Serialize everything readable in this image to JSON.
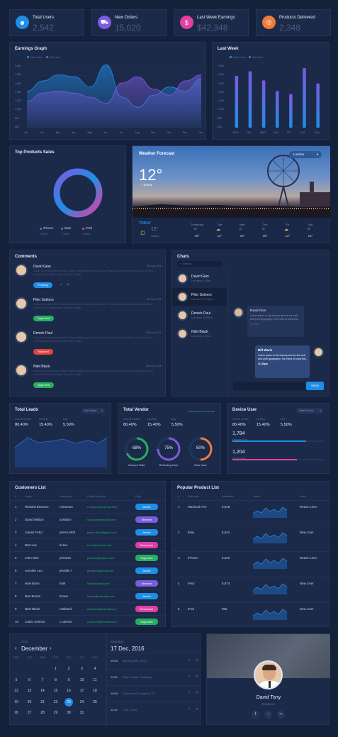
{
  "colors": {
    "bg": "#15203a",
    "card": "#1c2a4a",
    "blue": "#1f8ee6",
    "purple": "#7b5be0",
    "pink": "#e23fa2",
    "orange": "#f07b3a",
    "green": "#27ae60",
    "red": "#e0443c"
  },
  "stats": [
    {
      "label": "Total Users",
      "value": "2,542",
      "icon": "users-icon",
      "color": "#1f8ee6"
    },
    {
      "label": "New Orders",
      "value": "15,020",
      "icon": "cart-icon",
      "color": "#7b5be0"
    },
    {
      "label": "Last Week Earnings",
      "value": "$42,348",
      "icon": "dollar-icon",
      "color": "#e23fa2"
    },
    {
      "label": "Products Delivered",
      "value": "2,348",
      "icon": "delivery-icon",
      "color": "#f07b3a"
    }
  ],
  "earnings": {
    "title": "Earnings Graph",
    "legend": [
      "New User",
      "Old User"
    ],
    "chart_data": {
      "type": "area",
      "x": [
        "Jan",
        "Feb",
        "Mar",
        "Apr",
        "May",
        "Jun",
        "Jul",
        "Aug",
        "Sep",
        "Oct",
        "Nov",
        "Dec"
      ],
      "series": [
        {
          "name": "New User",
          "values": [
            1400,
            1650,
            1800,
            1750,
            1500,
            2050,
            1250,
            1000,
            1300,
            1500,
            1400,
            1700
          ]
        },
        {
          "name": "Old User",
          "values": [
            1150,
            1350,
            1400,
            1350,
            1250,
            1100,
            1600,
            1750,
            1450,
            1300,
            1650,
            1800
          ]
        }
      ],
      "ylim": [
        500,
        2000
      ],
      "yticks": [
        "2,000",
        "1,800",
        "1,600",
        "1,400",
        "1,200",
        "1,000",
        "800",
        "600"
      ]
    }
  },
  "lastweek": {
    "title": "Last Week",
    "legend": [
      "New User",
      "Old User"
    ],
    "chart_data": {
      "type": "bar",
      "categories": [
        "MON",
        "TUE",
        "WED",
        "THU",
        "FRI",
        "SAT",
        "SUN"
      ],
      "values": [
        1700,
        1850,
        1550,
        1200,
        1100,
        1950,
        1450
      ],
      "ylim": [
        0,
        2000
      ],
      "yticks": [
        "2,000",
        "1,800",
        "1,600",
        "1,400",
        "1,200",
        "1,000",
        "800",
        "600"
      ]
    }
  },
  "topproducts": {
    "title": "Top Products Sales",
    "chart_data": {
      "type": "pie",
      "series": [
        {
          "name": "iPhone",
          "value": "4,530"
        },
        {
          "name": "iMac",
          "value": "7,030"
        },
        {
          "name": "iPad",
          "value": "5,644"
        }
      ]
    }
  },
  "weather": {
    "title": "Weather Forecast",
    "city": "London",
    "temp": "12°",
    "cond": "Sunny",
    "today": "TODAY",
    "today_temp": "12°",
    "today_cond": "Sunny",
    "days": [
      {
        "d": "Tomorrow",
        "t": "18°"
      },
      {
        "d": "Tue",
        "t": "12°"
      },
      {
        "d": "Wed",
        "t": "18°"
      },
      {
        "d": "Thu",
        "t": "18°"
      },
      {
        "d": "Fri",
        "t": "12°"
      },
      {
        "d": "Sat",
        "t": "12°"
      }
    ]
  },
  "comments": {
    "title": "Comments",
    "items": [
      {
        "name": "David Gian",
        "date": "9th Aug 2016",
        "text": "Donec ac condimentum massa. Etiam pellentesque pretium lacus. Phasellus ultricies dictum suscipit. Aenean commodo dui pellentesque molestie feugiat.",
        "status": "Pending",
        "color": "#1f8ee6"
      },
      {
        "name": "Piter Solmon",
        "date": "9th Aug 2016",
        "text": "Donec ac condimentum massa. Etiam pellentesque pretium lacus. Phasellus ultricies dictum suscipit. Aenean commodo dui pellentesque molestie feugiat.",
        "status": "Approved",
        "color": "#27ae60"
      },
      {
        "name": "Denish Paul",
        "date": "10th Aug 2016",
        "text": "Donec ac condimentum massa. Etiam pellentesque pretium lacus. Phasellus ultricies dictum suscipit. Aenean commodo dui pellentesque molestie feugiat.",
        "status": "Rejected",
        "color": "#e0443c"
      },
      {
        "name": "Nitel Black",
        "date": "10th Aug 2016",
        "text": "Donec ac condimentum massa. Etiam pellentesque pretium lacus. Phasellus ultricies dictum suscipit. Aenean commodo dui pellentesque molestie feugiat.",
        "status": "Approved",
        "color": "#27ae60"
      }
    ]
  },
  "chats": {
    "title": "Chats",
    "search": "Search",
    "send": "SEND",
    "list": [
      {
        "name": "David Gian",
        "sub": "Last seen 1:00pm"
      },
      {
        "name": "Piter Solmon",
        "sub": "Last seen 12:20pm"
      },
      {
        "name": "Denish Paul",
        "sub": "Last seen 12:00pm"
      },
      {
        "name": "Nitel Black",
        "sub": "Last seen 1:00pm"
      }
    ],
    "msg1": {
      "name": "David Gian",
      "text": "Lorem ipsum is the dummy text for the web and print typography. You need to know this.",
      "time": "11:20pm"
    },
    "msg2": {
      "name": "Bill Waris",
      "text": "Lorem ipsum is the dummy text for the web and print typography. You need to know this.",
      "time": "11:28pm"
    }
  },
  "leads": {
    "title": "Total Leads",
    "select": "Sort Status",
    "h": [
      "Overall Growth",
      "Monthly",
      "Day"
    ],
    "v": [
      "80.40%",
      "15.40%",
      "5.50%"
    ]
  },
  "vendor": {
    "title": "Total Vendor",
    "link": "+ SEE AND FOLLOW MORE",
    "h": [
      "Overall Growth",
      "Monthly",
      "Day"
    ],
    "v": [
      "80.40%",
      "15.40%",
      "5.50%"
    ],
    "rings": [
      {
        "label": "Bounce Rate",
        "val": "68%",
        "pct": 68,
        "color": "#27ae60"
      },
      {
        "label": "Returning User",
        "val": "75%",
        "pct": 75,
        "color": "#7b5be0"
      },
      {
        "label": "New User",
        "val": "50%",
        "pct": 50,
        "color": "#f07b3a"
      }
    ]
  },
  "device": {
    "title": "Device User",
    "select": "Smart Phone",
    "h": [
      "Overall Growth",
      "Monthly",
      "Day"
    ],
    "v": [
      "80.40%",
      "15.40%",
      "5.50%"
    ],
    "bars": [
      {
        "v": "1,784",
        "label": "Desktop User",
        "pct": 80,
        "color": "#1f8ee6"
      },
      {
        "v": "1,204",
        "label": "Mobile User",
        "pct": 70,
        "color": "#e23fa2"
      }
    ]
  },
  "customers": {
    "title": "Customers List",
    "cols": [
      "#",
      "Name",
      "Username",
      "Email Address",
      "Role"
    ],
    "rows": [
      [
        "1",
        "Richard Branson",
        "r.branson",
        "r.branson@hotmail.com",
        "Admin",
        "#1f8ee6"
      ],
      [
        "2",
        "David Walton",
        "d.walton",
        "d.walton@hotmail.com",
        "Member",
        "#7b5be0"
      ],
      [
        "3",
        "James Fehd",
        "james.fehd",
        "james.fehd@gmail.com",
        "Admin",
        "#1f8ee6"
      ],
      [
        "4",
        "Bret Lee",
        "br.lee",
        "br.lee@hotmail.com",
        "Developer",
        "#e23fa2"
      ],
      [
        "5",
        "John Wez",
        "johnwez",
        "johnwez@yahoo.com",
        "Supporter",
        "#27ae60"
      ],
      [
        "6",
        "Jennifer Leo",
        "jennifer.l",
        "jennifer.l@gmail.com",
        "Admin",
        "#1f8ee6"
      ],
      [
        "7",
        "Haik Brian",
        "haik",
        "haik@hymail.com",
        "Member",
        "#7b5be0"
      ],
      [
        "8",
        "Dan Brown",
        "brown",
        "brown@example.com",
        "Admin",
        "#1f8ee6"
      ],
      [
        "9",
        "Nitel Black",
        "nitelback",
        "nitelback@hotmail.com",
        "Developer",
        "#e23fa2"
      ],
      [
        "10",
        "Catrin Solmon",
        "c.solmon",
        "c.solmon@hotmail.com",
        "Supporter",
        "#27ae60"
      ]
    ]
  },
  "products": {
    "title": "Popular Product List",
    "cols": [
      "#",
      "Products",
      "Available",
      "Sales",
      "User"
    ],
    "rows": [
      [
        "1",
        "Macbook Pro",
        "5,548",
        "Return User"
      ],
      [
        "2",
        "iMac",
        "5,541",
        "New User"
      ],
      [
        "3",
        "iPhone",
        "6,540",
        "Return User"
      ],
      [
        "4",
        "iPad",
        "8,874",
        "New User"
      ],
      [
        "5",
        "iPod",
        "982",
        "New User"
      ]
    ]
  },
  "calendar": {
    "year": "2016",
    "month": "December",
    "dow": [
      "MON",
      "TUE",
      "WED",
      "THU",
      "FRI",
      "SAT",
      "SUN"
    ],
    "days": [
      "",
      "",
      "",
      "1",
      "2",
      "3",
      "4",
      "5",
      "6",
      "7",
      "8",
      "9",
      "10",
      "11",
      "12",
      "13",
      "14",
      "15",
      "16",
      "17",
      "18",
      "19",
      "20",
      "21",
      "22",
      "23",
      "24",
      "25",
      "26",
      "27",
      "28",
      "29",
      "30",
      "31",
      ""
    ],
    "selected": "23",
    "weekday": "Saturday",
    "date": "17 Dec, 2016",
    "events": [
      {
        "t": "10:00",
        "e": "Meeting with Jenny"
      },
      {
        "t": "11:00",
        "e": "Daily Design Challenge"
      },
      {
        "t": "10:00",
        "e": "Dashboard Design for TS"
      },
      {
        "t": "11:40",
        "e": "CSS Coder"
      }
    ]
  },
  "profile": {
    "name": "David Tony",
    "role": "Designer"
  }
}
